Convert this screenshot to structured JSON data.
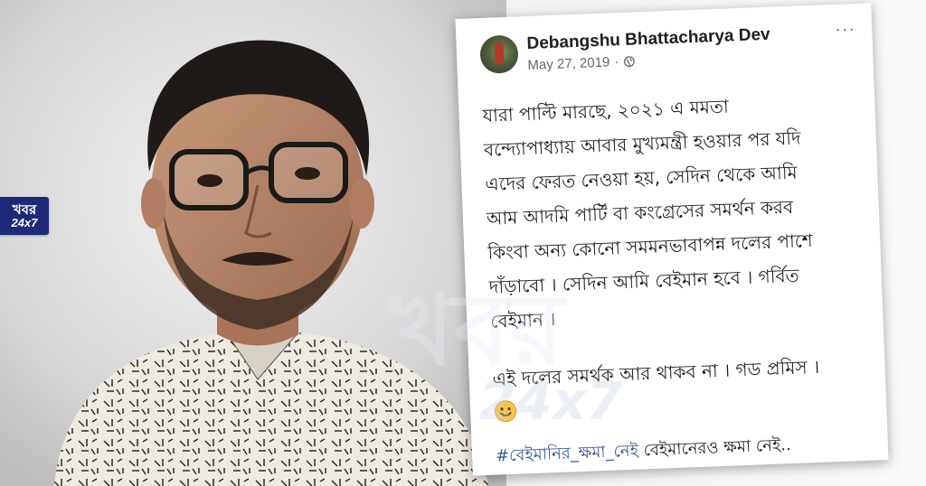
{
  "logo": {
    "line1": "খবর",
    "line2": "24x7"
  },
  "post": {
    "author": "Debangshu Bhattacharya Dev",
    "date": "May 27, 2019",
    "separator": "·",
    "more_label": "···",
    "paragraphs": [
      "যারা পাল্টি মারছে, ২০২১ এ মমতা",
      "বন্দ্যোপাধ্যায় আবার মুখ্যমন্ত্রী হওয়ার পর যদি",
      "এদের ফেরত নেওয়া হয়, সেদিন থেকে আমি",
      "আম আদমি পার্টি বা কংগ্রেসের সমর্থন করব",
      "কিংবা অন্য কোনো সমমনভাবাপন্ন দলের পাশে",
      "দাঁড়াবো । সেদিন আমি বেইমান হবে । গর্বিত",
      "বেইমান ।"
    ],
    "promise": "এই দলের সমর্থক আর থাকব না । গড প্রমিস ।",
    "hashtag": "#বেইমানির_ক্ষমা_নেই",
    "hashtag_tail": " বেইমানেরও ক্ষমা নেই.."
  },
  "watermark": {
    "line1": "খবর",
    "line2": "24x7"
  },
  "colors": {
    "logo_bg": "#1e2a78",
    "link": "#385898",
    "meta": "#65676b"
  },
  "icons": {
    "privacy": "globe-icon",
    "reaction": "smile-emoji-icon",
    "menu": "more-options-icon"
  }
}
